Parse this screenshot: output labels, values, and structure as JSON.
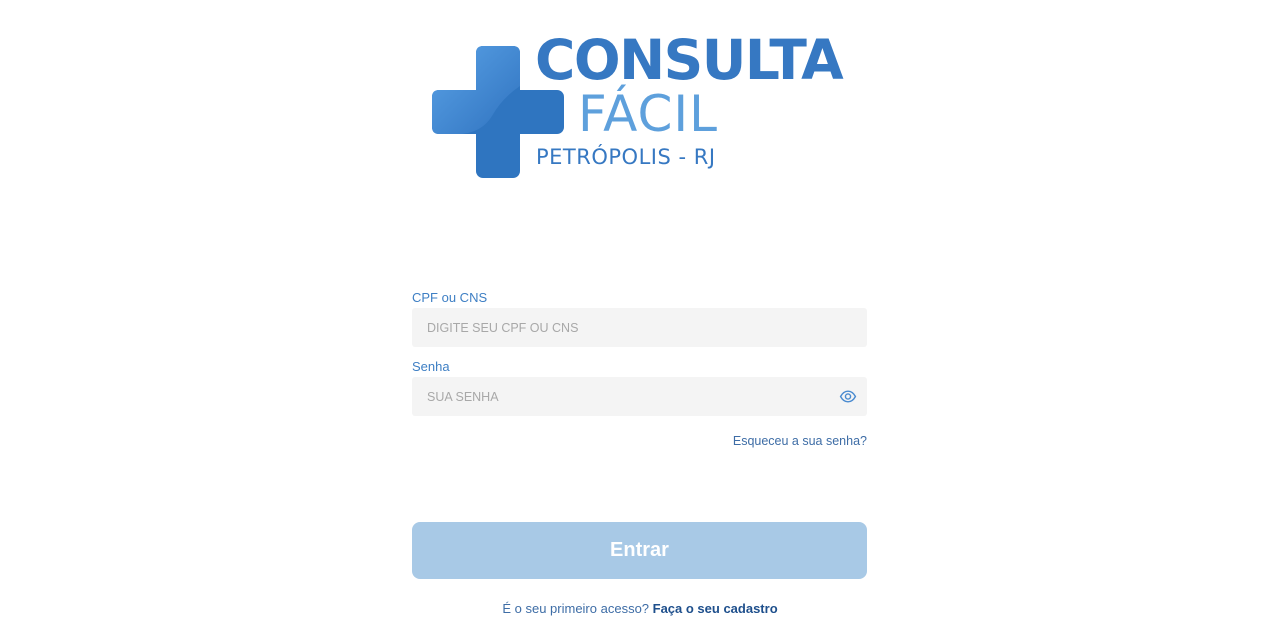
{
  "logo": {
    "title": "CONSULTA",
    "subtitle": "FÁCIL",
    "city": "PETRÓPOLIS - RJ",
    "icon": "medical-cross-icon",
    "colors": {
      "dark": "#3678c2",
      "light": "#5ea0dc"
    }
  },
  "form": {
    "cpf": {
      "label": "CPF ou CNS",
      "placeholder": "DIGITE SEU CPF OU CNS",
      "value": ""
    },
    "password": {
      "label": "Senha",
      "placeholder": "SUA SENHA",
      "value": "",
      "toggle_icon": "eye-icon"
    },
    "forgot_label": "Esqueceu a sua senha?",
    "submit_label": "Entrar"
  },
  "signup": {
    "prompt": "É o seu primeiro acesso?",
    "link_label": "Faça o seu cadastro"
  },
  "colors": {
    "accent": "#3e7fc4",
    "button_disabled": "#a8c9e6",
    "input_bg": "#f4f4f4"
  }
}
